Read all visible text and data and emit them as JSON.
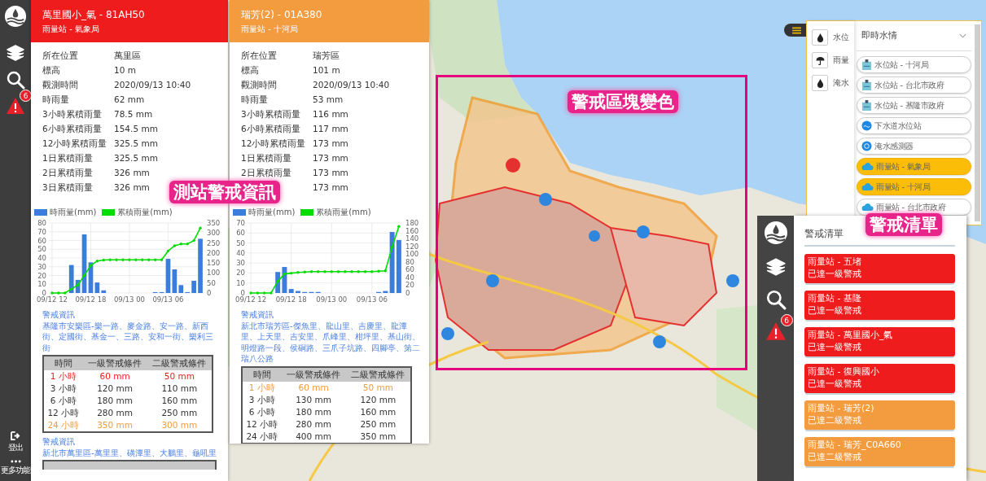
{
  "sidebar": {
    "badge": "6",
    "items": [
      {
        "kind": "logout",
        "label": "登出"
      },
      {
        "kind": "more",
        "label": "更多功能"
      }
    ]
  },
  "station_panels": [
    {
      "color": "#ee1c1c",
      "title": "萬里國小_氣 - 81AH50",
      "subtitle": "雨量站 - 氣象局",
      "info": [
        {
          "label": "所在位置",
          "value": "萬里區"
        },
        {
          "label": "標高",
          "value": "10 m"
        },
        {
          "label": "觀測時間",
          "value": "2020/09/13 10:40"
        },
        {
          "label": "時雨量",
          "value": "62 mm"
        },
        {
          "label": "3小時累積雨量",
          "value": "78.5 mm"
        },
        {
          "label": "6小時累積雨量",
          "value": "154.5 mm"
        },
        {
          "label": "12小時累積雨量",
          "value": "325.5 mm"
        },
        {
          "label": "1日累積雨量",
          "value": "325.5 mm"
        },
        {
          "label": "2日累積雨量",
          "value": "326 mm"
        },
        {
          "label": "3日累積雨量",
          "value": "326 mm"
        }
      ],
      "chart_data": {
        "type": "bar",
        "categories": [
          "09/12 12",
          null,
          null,
          null,
          null,
          null,
          "09/12 18",
          null,
          null,
          null,
          null,
          null,
          "09/13 00",
          null,
          null,
          null,
          null,
          null,
          "09/13 06",
          null,
          null,
          null,
          null,
          null
        ],
        "ylim": [
          0,
          80
        ],
        "yticks": [
          0,
          10,
          20,
          30,
          40,
          50,
          60,
          70,
          80
        ],
        "grid": true,
        "series": [
          {
            "name": "時雨量(mm)",
            "color": "#3b7ddd",
            "values": [
              0,
              0,
              0,
              32,
              15,
              67,
              35,
              12,
              3,
              0,
              0,
              0,
              0,
              0,
              0,
              0,
              1,
              1,
              39,
              27,
              9,
              1,
              14,
              62
            ]
          }
        ]
      },
      "cumulative_chart": {
        "chart_data": {
          "type": "line",
          "categories": [
            null,
            null,
            null,
            null,
            null,
            null,
            null,
            null,
            null,
            null,
            null,
            null,
            null,
            null,
            null,
            null,
            null,
            null,
            null,
            null,
            null,
            null,
            null,
            null
          ],
          "ylim": [
            0,
            350
          ],
          "yticks": [
            0,
            50,
            100,
            150,
            200,
            250,
            300,
            350
          ],
          "series": [
            {
              "name": "累積雨量(mm)",
              "color": "#00dd00",
              "values": [
                0,
                0,
                0,
                20,
                40,
                87,
                138,
                160,
                165,
                166,
                166,
                166,
                166,
                166,
                166,
                166,
                166,
                166,
                210,
                236,
                245,
                245,
                262,
                325
              ]
            }
          ]
        }
      },
      "warnings": [
        {
          "heading": "警戒資訊",
          "areas": "基隆市安樂區-樂一路、麥金路、安一路、新西街、定國街、基金一、三路、安和一街、樂利三街",
          "table": {
            "columns": [
              "時間",
              "一級警戒條件",
              "二級警戒條件"
            ],
            "rows": [
              {
                "color": "#ee1c1c",
                "cells": [
                  "1 小時",
                  "60 mm",
                  "50 mm"
                ]
              },
              {
                "color": "#333333",
                "cells": [
                  "3 小時",
                  "120 mm",
                  "110 mm"
                ]
              },
              {
                "color": "#333333",
                "cells": [
                  "6 小時",
                  "180 mm",
                  "160 mm"
                ]
              },
              {
                "color": "#333333",
                "cells": [
                  "12 小時",
                  "280 mm",
                  "250 mm"
                ]
              },
              {
                "color": "#f39b3f",
                "cells": [
                  "24 小時",
                  "350 mm",
                  "300 mm"
                ]
              }
            ]
          }
        },
        {
          "heading": "警戒資訊",
          "areas": "新北市萬里區-萬里里、磺潭里、大鵬里、龜吼里"
        }
      ]
    },
    {
      "color": "#f39b3f",
      "title": "瑞芳(2) - 01A380",
      "subtitle": "雨量站 - 十河局",
      "info": [
        {
          "label": "所在位置",
          "value": "瑞芳區"
        },
        {
          "label": "標高",
          "value": "101 m"
        },
        {
          "label": "觀測時間",
          "value": "2020/09/13 10:40"
        },
        {
          "label": "時雨量",
          "value": "53 mm"
        },
        {
          "label": "3小時累積雨量",
          "value": "116 mm"
        },
        {
          "label": "6小時累積雨量",
          "value": "117 mm"
        },
        {
          "label": "12小時累積雨量",
          "value": "173 mm"
        },
        {
          "label": "1日累積雨量",
          "value": "173 mm"
        },
        {
          "label": "2日累積雨量",
          "value": "173 mm"
        },
        {
          "value": "173 mm"
        }
      ],
      "chart_data": {
        "type": "bar",
        "categories": [
          "09/12 12",
          null,
          null,
          null,
          null,
          null,
          "09/12 18",
          null,
          null,
          null,
          null,
          null,
          "09/13 00",
          null,
          null,
          null,
          null,
          null,
          "09/13 06",
          null,
          null,
          null,
          null
        ],
        "ylim": [
          0,
          70
        ],
        "yticks": [
          0,
          10,
          20,
          30,
          40,
          50,
          60,
          70
        ],
        "grid": true,
        "series": [
          {
            "name": "時雨量(mm)",
            "color": "#3b7ddd",
            "values": [
              0,
              0,
              0,
              0,
              21,
              26,
              4,
              2,
              1,
              1,
              1,
              0,
              0,
              0,
              0,
              0,
              0,
              0,
              0,
              1,
              2,
              61,
              53
            ]
          }
        ]
      },
      "cumulative_chart": {
        "chart_data": {
          "type": "line",
          "categories": [
            null,
            null,
            null,
            null,
            null,
            null,
            null,
            null,
            null,
            null,
            null,
            null,
            null,
            null,
            null,
            null,
            null,
            null,
            null,
            null,
            null,
            null,
            null
          ],
          "ylim": [
            0,
            180
          ],
          "yticks": [
            0,
            20,
            40,
            60,
            80,
            100,
            120,
            140,
            160,
            180
          ],
          "series": [
            {
              "name": "累積雨量(mm)",
              "color": "#00dd00",
              "values": [
                0,
                0,
                0,
                0,
                30,
                49,
                51,
                53,
                54,
                55,
                55,
                55,
                55,
                55,
                55,
                55,
                55,
                55,
                55,
                56,
                57,
                118,
                171
              ]
            }
          ]
        }
      },
      "warnings": [
        {
          "heading": "警戒資訊",
          "areas": "新北市瑞芳區-傑魚里、龍山里、吉慶里、龍潭里、上天里、吉安里、爪峰里、柑坪里、基山街、明燈路一段、侯硐路、三爪子坑路、四腳亭、第二瑞八公路",
          "table": {
            "columns": [
              "時間",
              "一級警戒條件",
              "二級警戒條件"
            ],
            "rows": [
              {
                "color": "#f39b3f",
                "cells": [
                  "1 小時",
                  "60 mm",
                  "50 mm"
                ]
              },
              {
                "color": "#333333",
                "cells": [
                  "3 小時",
                  "130 mm",
                  "120 mm"
                ]
              },
              {
                "color": "#333333",
                "cells": [
                  "6 小時",
                  "180 mm",
                  "160 mm"
                ]
              },
              {
                "color": "#333333",
                "cells": [
                  "12 小時",
                  "280 mm",
                  "250 mm"
                ]
              },
              {
                "color": "#333333",
                "cells": [
                  "24 小時",
                  "400 mm",
                  "350 mm"
                ]
              }
            ]
          }
        }
      ]
    }
  ],
  "layer_panel": {
    "categories": [
      {
        "kind": "drop",
        "label": "水位"
      },
      {
        "kind": "umbrella",
        "label": "雨量"
      },
      {
        "kind": "drop",
        "label": "淹水"
      }
    ],
    "dropdown": "即時水情",
    "layers": [
      {
        "kind": "gauge",
        "label": "水位站 - 十河局",
        "selected": false
      },
      {
        "kind": "gauge",
        "label": "水位站 - 台北市政府",
        "selected": false
      },
      {
        "kind": "gauge",
        "label": "水位站 - 基隆市政府",
        "selected": false
      },
      {
        "kind": "sewer",
        "label": "下水道水位站",
        "selected": false
      },
      {
        "kind": "sensor",
        "label": "淹水感測器",
        "selected": false
      },
      {
        "kind": "rain",
        "label": "雨量站 - 氣象局",
        "selected": true
      },
      {
        "kind": "rain",
        "label": "雨量站 - 十河局",
        "selected": true
      },
      {
        "kind": "rain",
        "label": "雨量站 - 台北市政府",
        "selected": false
      }
    ]
  },
  "alert_list": {
    "badge": "6",
    "title": "警戒清單",
    "items": [
      {
        "color": "#ee1c1c",
        "name": "雨量站 - 五堵",
        "status": "已達一級警戒"
      },
      {
        "color": "#ee1c1c",
        "name": "雨量站 - 基隆",
        "status": "已達一級警戒"
      },
      {
        "color": "#ee1c1c",
        "name": "雨量站 - 萬里國小_氣",
        "status": "已達一級警戒"
      },
      {
        "color": "#ee1c1c",
        "name": "雨量站 - 復興國小",
        "status": "已達一級警戒"
      },
      {
        "color": "#f39b3f",
        "name": "雨量站 - 瑞芳(2)",
        "status": "已達二級警戒"
      },
      {
        "color": "#f39b3f",
        "name": "雨量站 - 瑞芳_C0A660",
        "status": "已達二級警戒"
      }
    ]
  },
  "annotations": [
    {
      "kind": "callout",
      "text": "測站警戒資訊"
    },
    {
      "kind": "frame",
      "text": "警戒區塊變色"
    },
    {
      "kind": "callout",
      "text": "警戒清單"
    }
  ]
}
